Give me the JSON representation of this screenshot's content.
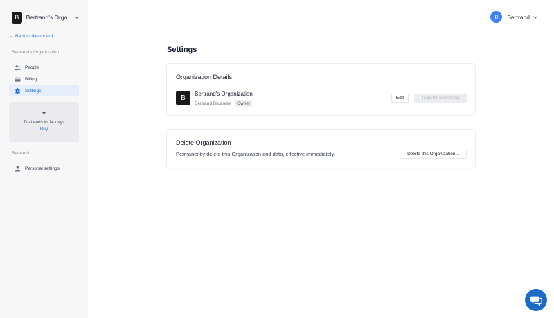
{
  "sidebar": {
    "org_avatar": "B",
    "org_name": "Bertrand's Orga...",
    "back_label": "Back to dashboard",
    "org_section_label": "Bertrand's Organization",
    "items": [
      {
        "label": "People",
        "icon": "people-icon"
      },
      {
        "label": "Billing",
        "icon": "credit-card-icon"
      },
      {
        "label": "Settings",
        "icon": "gear-icon"
      }
    ],
    "trial": {
      "text": "Trial ends in 14 days",
      "buy_label": "Buy"
    },
    "user_section_label": "Bertrand",
    "personal_settings_label": "Personal settings"
  },
  "header": {
    "user_avatar": "B",
    "user_name": "Bertrand"
  },
  "main": {
    "title": "Settings",
    "org_details": {
      "title": "Organization Details",
      "avatar": "B",
      "name": "Bertrand's Organization",
      "owner": "Bertrand Bruandet",
      "role_badge": "Owner",
      "edit_label": "Edit",
      "transfer_label": "Transfer ownership"
    },
    "delete_org": {
      "title": "Delete Organization",
      "description": "Permanently delete this Organization and data, effective immediately.",
      "button_label": "Delete this Organization..."
    }
  },
  "colors": {
    "accent": "#1d6fd1",
    "active_bg": "#e6eefb",
    "chat": "#1c6bc6"
  }
}
